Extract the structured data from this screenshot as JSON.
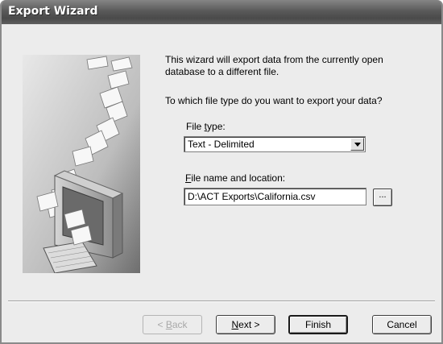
{
  "window": {
    "title": "Export Wizard"
  },
  "intro_text": "This wizard will export data from the currently open database to a different file.",
  "question_text": "To which file type do you want to export your data?",
  "file_type": {
    "label_prefix": "File ",
    "label_accel": "t",
    "label_suffix": "ype:",
    "value": "Text - Delimited"
  },
  "file_name": {
    "label_accel": "F",
    "label_suffix": "ile name and location:",
    "value": "D:\\ACT Exports\\California.csv",
    "browse_label": "..."
  },
  "buttons": {
    "back_prefix": "< ",
    "back_accel": "B",
    "back_suffix": "ack",
    "next_accel": "N",
    "next_suffix": "ext >",
    "finish": "Finish",
    "cancel": "Cancel"
  },
  "colors": {
    "titlebar": "#5a5a5a",
    "dialog_bg": "#ececec"
  },
  "illustration": {
    "icon": "computer-with-flying-documents"
  }
}
